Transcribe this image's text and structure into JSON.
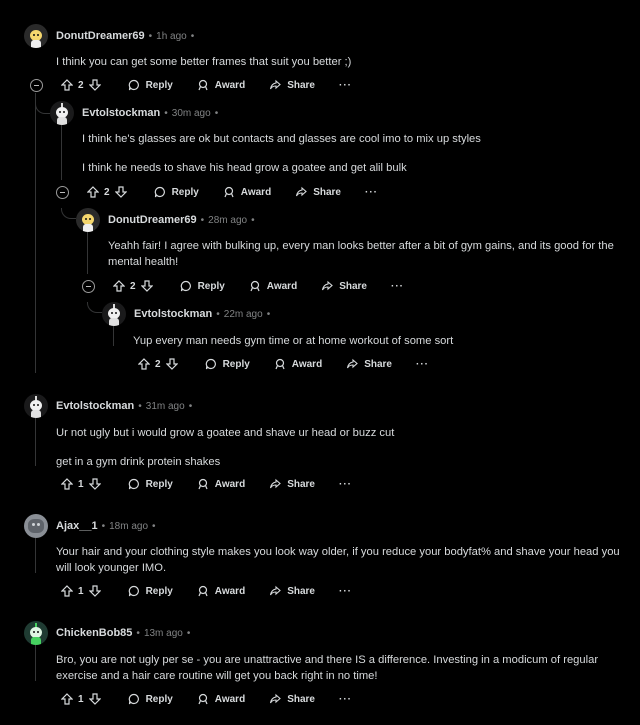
{
  "comments": [
    {
      "author": "DonutDreamer69",
      "time": "1h ago",
      "text": [
        "I think you can get some better frames that suit you better ;)"
      ],
      "votes": "2",
      "avatar": "yellow"
    },
    {
      "author": "Evtolstockman",
      "time": "30m ago",
      "text": [
        "I think he's glasses are ok but contacts and glasses are cool imo to mix up styles",
        "I think he needs to shave his head grow a goatee and get alil bulk"
      ],
      "votes": "2",
      "avatar": "gray"
    },
    {
      "author": "DonutDreamer69",
      "time": "28m ago",
      "text": [
        "Yeahh fair! I agree with bulking up, every man looks better after a bit of gym gains, and its good for the mental health!"
      ],
      "votes": "2",
      "avatar": "yellow"
    },
    {
      "author": "Evtolstockman",
      "time": "22m ago",
      "text": [
        "Yup every man needs gym time or at home workout of some sort"
      ],
      "votes": "2",
      "avatar": "gray"
    },
    {
      "author": "Evtolstockman",
      "time": "31m ago",
      "text": [
        "Ur not ugly but i would grow a goatee and shave ur head or buzz cut",
        "get in a gym drink protein shakes"
      ],
      "votes": "1",
      "avatar": "gray"
    },
    {
      "author": "Ajax__1",
      "time": "18m ago",
      "text": [
        "Your hair and your clothing style makes you look way older, if you reduce your bodyfat% and shave your head you will look younger IMO."
      ],
      "votes": "1",
      "avatar": "photo"
    },
    {
      "author": "ChickenBob85",
      "time": "13m ago",
      "text": [
        "Bro, you are not ugly per se - you are unattractive and there IS a difference. Investing in a modicum of regular exercise and a hair care routine will get you back right in no time!"
      ],
      "votes": "1",
      "avatar": "green"
    }
  ],
  "labels": {
    "reply": "Reply",
    "award": "Award",
    "share": "Share",
    "more": "···",
    "sep": "•"
  },
  "colors": {
    "background": "#000000",
    "text": "#d7dadc",
    "meta": "#818384",
    "thread_line": "#343536"
  }
}
